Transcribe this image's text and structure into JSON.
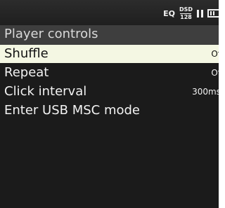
{
  "status_bar": {
    "eq_label": "EQ",
    "dsd_top": "DSD",
    "dsd_bottom": "128",
    "playback_icon": "pause-icon",
    "battery_icon": "battery-icon"
  },
  "title": "Player controls",
  "menu": {
    "items": [
      {
        "label": "Shuffle",
        "value": "Of",
        "selected": true
      },
      {
        "label": "Repeat",
        "value": "Of",
        "selected": false
      },
      {
        "label": "Click interval",
        "value": "300ms",
        "selected": false
      },
      {
        "label": "Enter USB MSC mode",
        "value": "",
        "selected": false
      }
    ]
  },
  "colors": {
    "screen_background": "#1b1b1b",
    "title_bar": "#3e3e3e",
    "selected_row": "#f4f7e3",
    "text": "#f2f2f2"
  }
}
